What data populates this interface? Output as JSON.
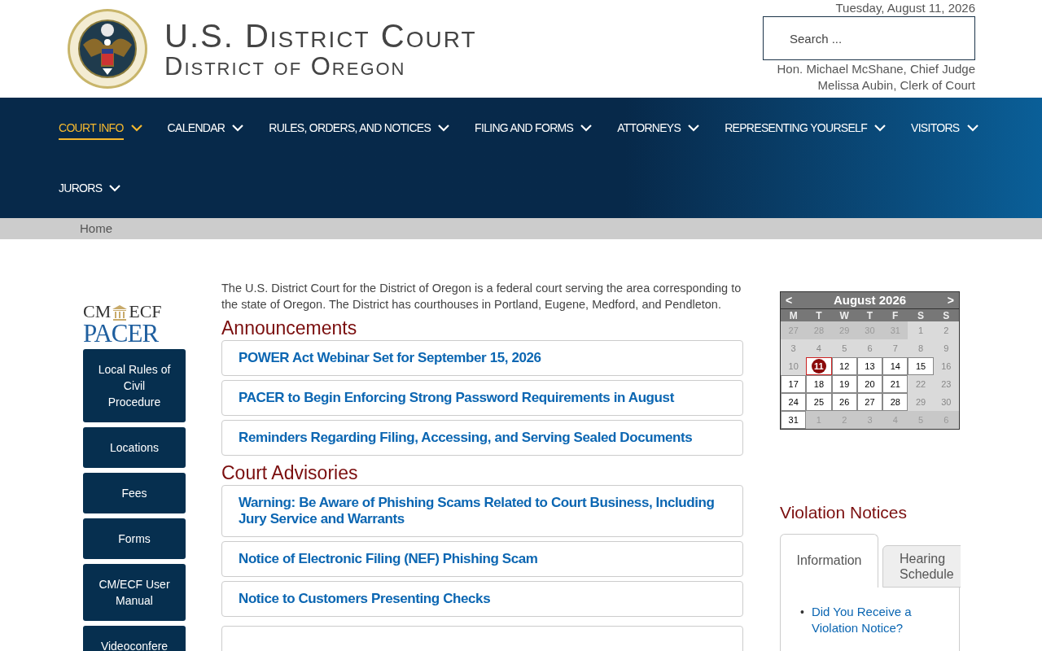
{
  "header": {
    "title": "U.S. District Court",
    "subtitle": "District of Oregon",
    "date": "Tuesday, August 11, 2026",
    "search": {
      "placeholder": "Search ..."
    },
    "officials": [
      "Hon. Michael McShane, Chief Judge",
      "Melissa Aubin, Clerk of Court"
    ]
  },
  "nav": [
    {
      "label": "COURT INFO",
      "selected": true
    },
    {
      "label": "CALENDAR",
      "selected": false
    },
    {
      "label": "RULES, ORDERS, AND NOTICES",
      "selected": false
    },
    {
      "label": "FILING AND FORMS",
      "selected": false
    },
    {
      "label": "ATTORNEYS",
      "selected": false
    },
    {
      "label": "REPRESENTING YOURSELF",
      "selected": false
    },
    {
      "label": "VISITORS",
      "selected": false
    },
    {
      "label": "JURORS",
      "selected": false
    }
  ],
  "breadcrumb": [
    "Home"
  ],
  "sidebar": {
    "logo": {
      "top_left": "CM",
      "top_right": "ECF",
      "bottom": "PACER"
    },
    "buttons": [
      "Local Rules of Civil Procedure",
      "Locations",
      "Fees",
      "Forms",
      "CM/ECF User Manual",
      "Videoconfere"
    ]
  },
  "intro": "The U.S. District Court for the District of Oregon is a federal court serving the area corresponding to the state of Oregon. The District has courthouses in Portland, Eugene, Medford, and Pendleton.",
  "sections": [
    {
      "heading": "Announcements",
      "items": [
        "POWER Act Webinar Set for September 15, 2026",
        "PACER to Begin Enforcing Strong Password Requirements in August",
        "Reminders Regarding Filing, Accessing, and Serving Sealed Documents"
      ]
    },
    {
      "heading": "Court Advisories",
      "items": [
        "Warning: Be Aware of Phishing Scams Related to Court Business, Including Jury Service and Warrants",
        "Notice of Electronic Filing (NEF) Phishing Scam",
        "Notice to Customers Presenting Checks"
      ]
    }
  ],
  "calendar": {
    "prev": "<",
    "month": "August 2026",
    "next": ">",
    "weekdays": [
      "M",
      "T",
      "W",
      "T",
      "F",
      "S",
      "S"
    ],
    "days": [
      {
        "label": "27",
        "kind": "other"
      },
      {
        "label": "28",
        "kind": "other"
      },
      {
        "label": "29",
        "kind": "other"
      },
      {
        "label": "30",
        "kind": "other"
      },
      {
        "label": "31",
        "kind": "other"
      },
      {
        "label": "1",
        "kind": "plain"
      },
      {
        "label": "2",
        "kind": "plain"
      },
      {
        "label": "3",
        "kind": "plain"
      },
      {
        "label": "4",
        "kind": "plain"
      },
      {
        "label": "5",
        "kind": "plain"
      },
      {
        "label": "6",
        "kind": "plain"
      },
      {
        "label": "7",
        "kind": "plain"
      },
      {
        "label": "8",
        "kind": "plain"
      },
      {
        "label": "9",
        "kind": "plain"
      },
      {
        "label": "10",
        "kind": "plain"
      },
      {
        "label": "11",
        "kind": "today"
      },
      {
        "label": "12",
        "kind": "event"
      },
      {
        "label": "13",
        "kind": "event"
      },
      {
        "label": "14",
        "kind": "event"
      },
      {
        "label": "15",
        "kind": "event"
      },
      {
        "label": "16",
        "kind": "plain"
      },
      {
        "label": "17",
        "kind": "event"
      },
      {
        "label": "18",
        "kind": "event"
      },
      {
        "label": "19",
        "kind": "event"
      },
      {
        "label": "20",
        "kind": "event"
      },
      {
        "label": "21",
        "kind": "event"
      },
      {
        "label": "22",
        "kind": "plain"
      },
      {
        "label": "23",
        "kind": "plain"
      },
      {
        "label": "24",
        "kind": "event"
      },
      {
        "label": "25",
        "kind": "event"
      },
      {
        "label": "26",
        "kind": "event"
      },
      {
        "label": "27",
        "kind": "event"
      },
      {
        "label": "28",
        "kind": "event"
      },
      {
        "label": "29",
        "kind": "plain"
      },
      {
        "label": "30",
        "kind": "plain"
      },
      {
        "label": "31",
        "kind": "event"
      },
      {
        "label": "1",
        "kind": "other"
      },
      {
        "label": "2",
        "kind": "other"
      },
      {
        "label": "3",
        "kind": "other"
      },
      {
        "label": "4",
        "kind": "other"
      },
      {
        "label": "5",
        "kind": "other"
      },
      {
        "label": "6",
        "kind": "other"
      }
    ]
  },
  "violations": {
    "heading": "Violation Notices",
    "tabs": [
      {
        "label": "Information",
        "selected": true
      },
      {
        "label": "Hearing Schedule",
        "selected": false
      }
    ],
    "links": [
      {
        "bullet": "•",
        "text": "Did You Receive a Violation Notice?"
      }
    ]
  }
}
